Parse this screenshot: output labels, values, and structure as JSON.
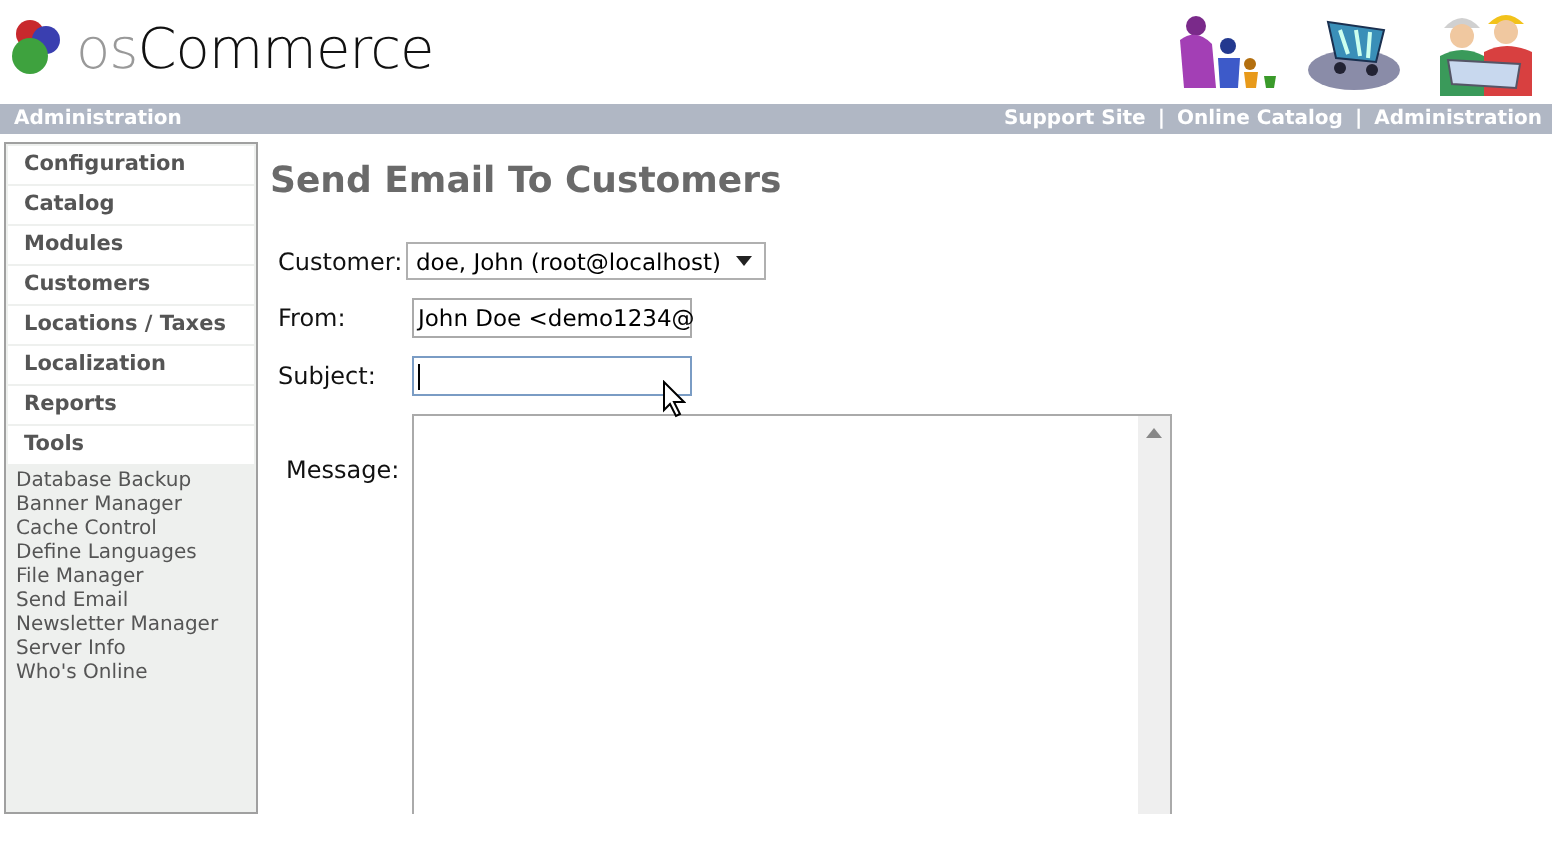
{
  "logo": {
    "prefix": "os",
    "name": "Commerce"
  },
  "header_bar": {
    "title": "Administration",
    "links": [
      "Support Site",
      "Online Catalog",
      "Administration"
    ],
    "separator": "|"
  },
  "sidebar": {
    "sections": [
      {
        "label": "Configuration"
      },
      {
        "label": "Catalog"
      },
      {
        "label": "Modules"
      },
      {
        "label": "Customers"
      },
      {
        "label": "Locations / Taxes"
      },
      {
        "label": "Localization"
      },
      {
        "label": "Reports"
      },
      {
        "label": "Tools",
        "items": [
          "Database Backup",
          "Banner Manager",
          "Cache Control",
          "Define Languages",
          "File Manager",
          "Send Email",
          "Newsletter Manager",
          "Server Info",
          "Who's Online"
        ]
      }
    ]
  },
  "page_title": "Send Email To Customers",
  "form": {
    "customer": {
      "label": "Customer:",
      "value": "doe, John (root@localhost)"
    },
    "from": {
      "label": "From:",
      "value": "John Doe <demo1234@"
    },
    "subject": {
      "label": "Subject:",
      "focused": true
    },
    "message": {
      "label": "Message:"
    }
  }
}
